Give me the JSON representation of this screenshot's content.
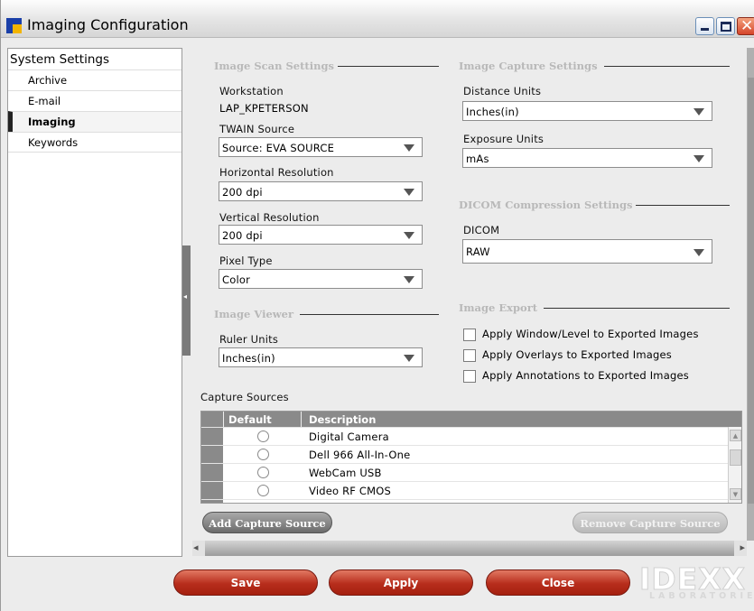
{
  "window": {
    "title": "Imaging Configuration",
    "icon": "app-icon",
    "controls": [
      "minimize-icon",
      "maximize-icon",
      "close-icon"
    ]
  },
  "sidebar": {
    "header": "System Settings",
    "items": [
      {
        "label": "Archive",
        "selected": false
      },
      {
        "label": "E-mail",
        "selected": false
      },
      {
        "label": "Imaging",
        "selected": true
      },
      {
        "label": "Keywords",
        "selected": false
      }
    ]
  },
  "scan": {
    "title": "Image Scan Settings",
    "workstation_label": "Workstation",
    "workstation_value": "LAP_KPETERSON",
    "twain_label": "TWAIN Source",
    "twain_value": "Source: EVA SOURCE",
    "hres_label": "Horizontal Resolution",
    "hres_value": "200 dpi",
    "vres_label": "Vertical Resolution",
    "vres_value": "200 dpi",
    "pixel_label": "Pixel Type",
    "pixel_value": "Color"
  },
  "viewer": {
    "title": "Image Viewer",
    "ruler_label": "Ruler Units",
    "ruler_value": "Inches(in)"
  },
  "capture": {
    "title": "Image Capture Settings",
    "distance_label": "Distance Units",
    "distance_value": "Inches(in)",
    "exposure_label": "Exposure Units",
    "exposure_value": "mAs"
  },
  "dicom": {
    "title": "DICOM Compression Settings",
    "label": "DICOM",
    "value": "RAW"
  },
  "export": {
    "title": "Image Export",
    "options": [
      {
        "label": "Apply Window/Level to Exported Images",
        "checked": false
      },
      {
        "label": "Apply Overlays to Exported Images",
        "checked": false
      },
      {
        "label": "Apply Annotations to Exported Images",
        "checked": false
      }
    ]
  },
  "sources": {
    "title": "Capture Sources",
    "columns": [
      "Default",
      "Description"
    ],
    "rows": [
      {
        "description": "Digital Camera",
        "default": false
      },
      {
        "description": "Dell 966 All-In-One",
        "default": false
      },
      {
        "description": "WebCam USB",
        "default": false
      },
      {
        "description": "Video RF CMOS",
        "default": false
      }
    ],
    "add_label": "Add Capture Source",
    "remove_label": "Remove Capture Source"
  },
  "footer": {
    "save_label": "Save",
    "apply_label": "Apply",
    "close_label": "Close",
    "logo_text": "IDEXX",
    "logo_sub": "LABORATORIES"
  },
  "colors": {
    "accent_red": "#b72d1c",
    "section_gray": "#b8b8b8",
    "header_gray": "#8a8a8a"
  }
}
